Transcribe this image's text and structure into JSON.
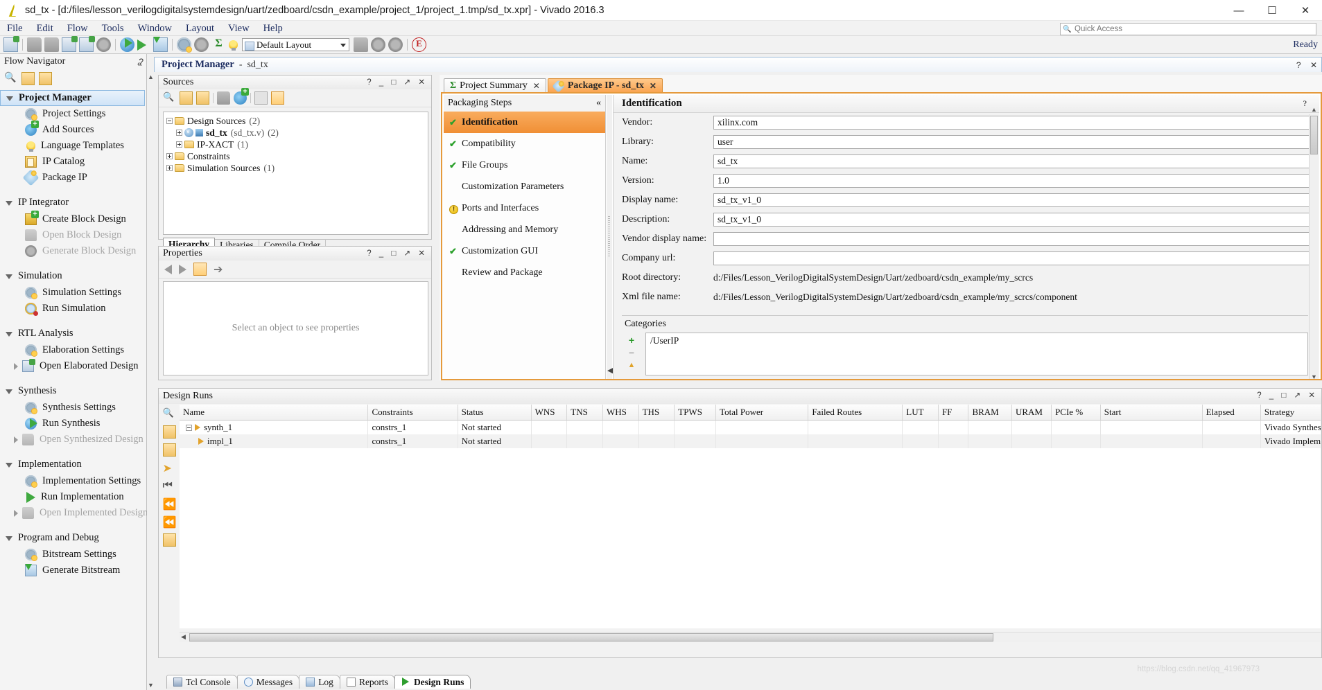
{
  "window": {
    "title": "sd_tx - [d:/files/lesson_verilogdigitalsystemdesign/uart/zedboard/csdn_example/project_1/project_1.tmp/sd_tx.xpr] - Vivado 2016.3",
    "minimize": "—",
    "maximize": "☐",
    "close": "✕",
    "app_icon": "vivado-logo-icon"
  },
  "menubar": {
    "items": [
      "File",
      "Edit",
      "Flow",
      "Tools",
      "Window",
      "Layout",
      "View",
      "Help"
    ],
    "quick_access_placeholder": "Quick Access"
  },
  "toolbar": {
    "layout_combo": "Default Layout",
    "ready_label": "Ready"
  },
  "flow_navigator": {
    "title": "Flow Navigator",
    "help": "?",
    "collapse": "«",
    "sections": [
      {
        "label": "Project Manager",
        "selected": true,
        "items": [
          {
            "label": "Project Settings",
            "icon": "gear-icon",
            "disabled": false
          },
          {
            "label": "Add Sources",
            "icon": "add-sources-icon",
            "disabled": false
          },
          {
            "label": "Language Templates",
            "icon": "lightbulb-icon",
            "disabled": false
          },
          {
            "label": "IP Catalog",
            "icon": "ip-catalog-icon",
            "disabled": false
          },
          {
            "label": "Package IP",
            "icon": "package-ip-icon",
            "disabled": false
          }
        ]
      },
      {
        "label": "IP Integrator",
        "selected": false,
        "items": [
          {
            "label": "Create Block Design",
            "icon": "create-block-design-icon",
            "disabled": false
          },
          {
            "label": "Open Block Design",
            "icon": "open-block-design-icon",
            "disabled": true
          },
          {
            "label": "Generate Block Design",
            "icon": "generate-block-design-icon",
            "disabled": true
          }
        ]
      },
      {
        "label": "Simulation",
        "selected": false,
        "items": [
          {
            "label": "Simulation Settings",
            "icon": "gear-icon",
            "disabled": false
          },
          {
            "label": "Run Simulation",
            "icon": "run-simulation-icon",
            "disabled": false
          }
        ]
      },
      {
        "label": "RTL Analysis",
        "selected": false,
        "items": [
          {
            "label": "Elaboration Settings",
            "icon": "gear-icon",
            "disabled": false
          },
          {
            "label": "Open Elaborated Design",
            "icon": "open-elaborated-design-icon",
            "disabled": false,
            "expandable": true
          }
        ]
      },
      {
        "label": "Synthesis",
        "selected": false,
        "items": [
          {
            "label": "Synthesis Settings",
            "icon": "gear-icon",
            "disabled": false
          },
          {
            "label": "Run Synthesis",
            "icon": "run-synthesis-icon",
            "disabled": false
          },
          {
            "label": "Open Synthesized Design",
            "icon": "open-synthesized-design-icon",
            "disabled": true,
            "expandable": true
          }
        ]
      },
      {
        "label": "Implementation",
        "selected": false,
        "items": [
          {
            "label": "Implementation Settings",
            "icon": "gear-icon",
            "disabled": false
          },
          {
            "label": "Run Implementation",
            "icon": "play-icon",
            "disabled": false
          },
          {
            "label": "Open Implemented Design",
            "icon": "open-implemented-design-icon",
            "disabled": true,
            "expandable": true
          }
        ]
      },
      {
        "label": "Program and Debug",
        "selected": false,
        "items": [
          {
            "label": "Bitstream Settings",
            "icon": "gear-icon",
            "disabled": false
          },
          {
            "label": "Generate Bitstream",
            "icon": "generate-bitstream-icon",
            "disabled": false
          }
        ]
      }
    ]
  },
  "workspace_tab": {
    "title": "Project Manager",
    "separator": "-",
    "project": "sd_tx",
    "help": "?",
    "close": "✕"
  },
  "sources": {
    "title": "Sources",
    "controls": "? _ □ ↗ ✕",
    "tree": [
      {
        "label": "Design Sources",
        "count": "(2)",
        "indent": 0,
        "expanded": true,
        "icon": "folder-icon"
      },
      {
        "label": "sd_tx",
        "detail": "(sd_tx.v)",
        "count": "(2)",
        "indent": 1,
        "expanded": false,
        "icon": "verilog-module-icon",
        "bold": true
      },
      {
        "label": "IP-XACT",
        "count": "(1)",
        "indent": 1,
        "expanded": false,
        "icon": "folder-icon"
      },
      {
        "label": "Constraints",
        "count": "",
        "indent": 0,
        "expanded": false,
        "icon": "folder-icon"
      },
      {
        "label": "Simulation Sources",
        "count": "(1)",
        "indent": 0,
        "expanded": false,
        "icon": "folder-icon"
      }
    ],
    "tabs": [
      {
        "label": "Hierarchy",
        "active": true
      },
      {
        "label": "Libraries",
        "active": false
      },
      {
        "label": "Compile Order",
        "active": false
      }
    ]
  },
  "properties": {
    "title": "Properties",
    "controls": "? _ □ ↗ ✕",
    "empty_message": "Select an object to see properties"
  },
  "ip_tabs": [
    {
      "label": "Project Summary",
      "icon": "sigma-icon",
      "active": false,
      "close": "✕"
    },
    {
      "label": "Package IP - sd_tx",
      "icon": "package-ip-icon",
      "active": true,
      "close": "✕"
    }
  ],
  "packaging": {
    "header": "Packaging Steps",
    "collapse": "«",
    "steps": [
      {
        "label": "Identification",
        "state": "done",
        "active": true
      },
      {
        "label": "Compatibility",
        "state": "done",
        "active": false
      },
      {
        "label": "File Groups",
        "state": "done",
        "active": false
      },
      {
        "label": "Customization Parameters",
        "state": "none",
        "active": false
      },
      {
        "label": "Ports and Interfaces",
        "state": "warning",
        "active": false
      },
      {
        "label": "Addressing and Memory",
        "state": "none",
        "active": false
      },
      {
        "label": "Customization GUI",
        "state": "done",
        "active": false
      },
      {
        "label": "Review and Package",
        "state": "none",
        "active": false
      }
    ]
  },
  "identification": {
    "title": "Identification",
    "help": "?",
    "fields": [
      {
        "label": "Vendor:",
        "value": "xilinx.com",
        "type": "input"
      },
      {
        "label": "Library:",
        "value": "user",
        "type": "input"
      },
      {
        "label": "Name:",
        "value": "sd_tx",
        "type": "input"
      },
      {
        "label": "Version:",
        "value": "1.0",
        "type": "input"
      },
      {
        "label": "Display name:",
        "value": "sd_tx_v1_0",
        "type": "input"
      },
      {
        "label": "Description:",
        "value": "sd_tx_v1_0",
        "type": "input"
      },
      {
        "label": "Vendor display name:",
        "value": "",
        "type": "input"
      },
      {
        "label": "Company url:",
        "value": "",
        "type": "input"
      },
      {
        "label": "Root directory:",
        "value": "d:/Files/Lesson_VerilogDigitalSystemDesign/Uart/zedboard/csdn_example/my_scrcs",
        "type": "text"
      },
      {
        "label": "Xml file name:",
        "value": "d:/Files/Lesson_VerilogDigitalSystemDesign/Uart/zedboard/csdn_example/my_scrcs/component",
        "type": "text"
      }
    ],
    "categories_label": "Categories",
    "categories": [
      "/UserIP"
    ],
    "category_buttons": [
      "+",
      "−",
      "▲"
    ]
  },
  "design_runs": {
    "title": "Design Runs",
    "controls": "? _ □ ↗ ✕",
    "columns": [
      "Name",
      "Constraints",
      "Status",
      "WNS",
      "TNS",
      "WHS",
      "THS",
      "TPWS",
      "Total Power",
      "Failed Routes",
      "LUT",
      "FF",
      "BRAM",
      "URAM",
      "PCIe %",
      "Start",
      "Elapsed",
      "Strategy"
    ],
    "rows": [
      {
        "name": "synth_1",
        "indent": 0,
        "expanded": true,
        "constraints": "constrs_1",
        "status": "Not started",
        "wns": "",
        "tns": "",
        "whs": "",
        "ths": "",
        "tpws": "",
        "total_power": "",
        "failed_routes": "",
        "lut": "",
        "ff": "",
        "bram": "",
        "uram": "",
        "pcie": "",
        "start": "",
        "elapsed": "",
        "strategy": "Vivado Synthesis Defaults ("
      },
      {
        "name": "impl_1",
        "indent": 1,
        "expanded": false,
        "constraints": "constrs_1",
        "status": "Not started",
        "wns": "",
        "tns": "",
        "whs": "",
        "ths": "",
        "tpws": "",
        "total_power": "",
        "failed_routes": "",
        "lut": "",
        "ff": "",
        "bram": "",
        "uram": "",
        "pcie": "",
        "start": "",
        "elapsed": "",
        "strategy": "Vivado Implementation Defau"
      }
    ]
  },
  "bottom_tabs": [
    {
      "label": "Tcl Console",
      "icon": "tcl-console-icon",
      "active": false
    },
    {
      "label": "Messages",
      "icon": "messages-icon",
      "active": false
    },
    {
      "label": "Log",
      "icon": "log-icon",
      "active": false
    },
    {
      "label": "Reports",
      "icon": "reports-icon",
      "active": false
    },
    {
      "label": "Design Runs",
      "icon": "design-runs-icon",
      "active": true
    }
  ],
  "watermark": "https://blog.csdn.net/qq_41967973"
}
